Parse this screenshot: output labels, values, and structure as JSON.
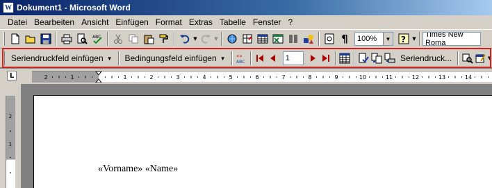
{
  "window": {
    "title": "Dokument1 - Microsoft Word",
    "app_icon_letter": "W"
  },
  "menu": [
    {
      "label": "Datei"
    },
    {
      "label": "Bearbeiten"
    },
    {
      "label": "Ansicht"
    },
    {
      "label": "Einfügen"
    },
    {
      "label": "Format"
    },
    {
      "label": "Extras"
    },
    {
      "label": "Tabelle"
    },
    {
      "label": "Fenster"
    },
    {
      "label": "?"
    }
  ],
  "standard_toolbar": {
    "zoom": "100%",
    "font": "Times New Roma"
  },
  "mailmerge_toolbar": {
    "insert_merge_field": "Seriendruckfeld einfügen",
    "insert_word_field": "Bedingungsfeld einfügen",
    "record_number": "1",
    "merge_button": "Seriendruck..."
  },
  "ruler": {
    "numbers": [
      "2",
      "1",
      "1",
      "2",
      "3",
      "4",
      "5",
      "6",
      "7",
      "8",
      "9",
      "10",
      "11",
      "12",
      "13",
      "14"
    ]
  },
  "document": {
    "text": "«Vorname» «Name»"
  },
  "colors": {
    "highlight": "#d6221b",
    "titlebar": "#0a246a"
  }
}
